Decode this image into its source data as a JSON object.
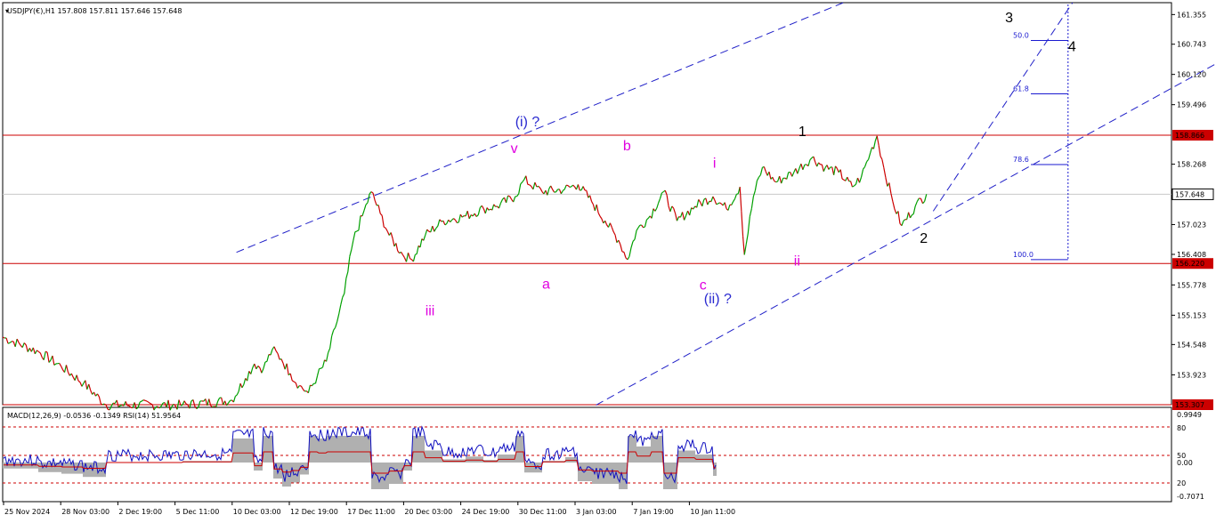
{
  "header": {
    "symbol_line": "USDJPY(€),H1  157.808 157.811 157.646 157.648",
    "indicator_line": "MACD(12,26,9) -0.0536 -0.1349  RSI(14) 51.9564"
  },
  "chart_data": {
    "type": "line",
    "title": "USDJPY(€),H1",
    "price_axis": {
      "ticks": [
        "161.355",
        "160.743",
        "160.120",
        "159.496",
        "158.268",
        "157.023",
        "156.408",
        "155.778",
        "155.153",
        "154.548",
        "153.923"
      ],
      "ylim": [
        153.307,
        161.6
      ]
    },
    "time_axis": {
      "ticks": [
        "25 Nov 2024",
        "28 Nov 03:00",
        "2 Dec 19:00",
        "5 Dec 11:00",
        "10 Dec 03:00",
        "12 Dec 19:00",
        "17 Dec 11:00",
        "20 Dec 03:00",
        "24 Dec 19:00",
        "30 Dec 11:00",
        "3 Jan 03:00",
        "7 Jan 19:00",
        "10 Jan 11:00"
      ]
    },
    "horizontal_lines": [
      {
        "price": 158.866,
        "label": "158.866",
        "color": "#cc0000"
      },
      {
        "price": 156.22,
        "label": "156.220",
        "color": "#cc0000"
      },
      {
        "price": 153.307,
        "label": "153.307",
        "color": "#cc0000"
      }
    ],
    "current_price": {
      "price": 157.648,
      "label": "157.648"
    },
    "price_path": [
      {
        "t": 0.0,
        "p": 154.7
      },
      {
        "t": 0.8,
        "p": 154.4
      },
      {
        "t": 1.3,
        "p": 154.1
      },
      {
        "t": 1.8,
        "p": 153.75
      },
      {
        "t": 2.3,
        "p": 153.3
      },
      {
        "t": 4.0,
        "p": 153.3
      },
      {
        "t": 5.1,
        "p": 153.4
      },
      {
        "t": 5.4,
        "p": 153.85
      },
      {
        "t": 5.6,
        "p": 154.15
      },
      {
        "t": 5.8,
        "p": 154.05
      },
      {
        "t": 6.0,
        "p": 154.45
      },
      {
        "t": 6.2,
        "p": 154.25
      },
      {
        "t": 6.4,
        "p": 153.95
      },
      {
        "t": 6.6,
        "p": 153.7
      },
      {
        "t": 6.8,
        "p": 153.55
      },
      {
        "t": 7.0,
        "p": 153.9
      },
      {
        "t": 7.2,
        "p": 154.2
      },
      {
        "t": 7.4,
        "p": 154.9
      },
      {
        "t": 7.6,
        "p": 155.6
      },
      {
        "t": 7.8,
        "p": 156.7
      },
      {
        "t": 8.0,
        "p": 157.2
      },
      {
        "t": 8.2,
        "p": 157.7
      },
      {
        "t": 8.4,
        "p": 157.25
      },
      {
        "t": 8.6,
        "p": 156.8
      },
      {
        "t": 8.9,
        "p": 156.4
      },
      {
        "t": 9.1,
        "p": 156.3
      },
      {
        "t": 9.4,
        "p": 156.8
      },
      {
        "t": 9.8,
        "p": 157.1
      },
      {
        "t": 10.3,
        "p": 157.2
      },
      {
        "t": 10.7,
        "p": 157.35
      },
      {
        "t": 11.0,
        "p": 157.4
      },
      {
        "t": 11.4,
        "p": 157.6
      },
      {
        "t": 11.6,
        "p": 157.95
      },
      {
        "t": 12.0,
        "p": 157.7
      },
      {
        "t": 12.5,
        "p": 157.75
      },
      {
        "t": 12.8,
        "p": 157.85
      },
      {
        "t": 13.1,
        "p": 157.5
      },
      {
        "t": 13.4,
        "p": 157.1
      },
      {
        "t": 13.7,
        "p": 156.7
      },
      {
        "t": 13.9,
        "p": 156.3
      },
      {
        "t": 14.1,
        "p": 156.9
      },
      {
        "t": 14.4,
        "p": 157.2
      },
      {
        "t": 14.7,
        "p": 157.7
      },
      {
        "t": 15.0,
        "p": 157.1
      },
      {
        "t": 15.4,
        "p": 157.4
      },
      {
        "t": 15.8,
        "p": 157.6
      },
      {
        "t": 16.1,
        "p": 157.35
      },
      {
        "t": 16.4,
        "p": 157.8
      },
      {
        "t": 16.5,
        "p": 156.4
      },
      {
        "t": 16.7,
        "p": 157.6
      },
      {
        "t": 16.9,
        "p": 158.2
      },
      {
        "t": 17.2,
        "p": 157.9
      },
      {
        "t": 17.6,
        "p": 158.1
      },
      {
        "t": 18.0,
        "p": 158.4
      },
      {
        "t": 18.3,
        "p": 158.2
      },
      {
        "t": 18.6,
        "p": 158.1
      },
      {
        "t": 18.9,
        "p": 157.8
      },
      {
        "t": 19.1,
        "p": 158.0
      },
      {
        "t": 19.3,
        "p": 158.5
      },
      {
        "t": 19.45,
        "p": 158.85
      },
      {
        "t": 19.6,
        "p": 158.2
      },
      {
        "t": 19.8,
        "p": 157.5
      },
      {
        "t": 20.0,
        "p": 157.0
      },
      {
        "t": 20.3,
        "p": 157.4
      },
      {
        "t": 20.55,
        "p": 157.65
      }
    ],
    "projection_lines": [
      {
        "from": {
          "t": 20.7,
          "p": 157.3
        },
        "to": {
          "t": 23.8,
          "p": 161.6
        }
      }
    ],
    "channel": {
      "upper": {
        "from": {
          "t": 5.2,
          "p": 156.45
        },
        "to": {
          "t": 18.7,
          "p": 161.6
        }
      },
      "lower": {
        "from": {
          "t": 13.2,
          "p": 153.3
        },
        "to": {
          "t": 27.5,
          "p": 160.6
        }
      }
    },
    "fib_levels": [
      {
        "label": "50.0",
        "price": 160.82
      },
      {
        "label": "61.8",
        "price": 159.72
      },
      {
        "label": "78.6",
        "price": 158.26
      },
      {
        "label": "100.0",
        "price": 156.3
      }
    ],
    "wave_labels": [
      {
        "text": "(i) ?",
        "t": 11.4,
        "p": 159.05,
        "color": "#2a2ad0"
      },
      {
        "text": "v",
        "t": 11.3,
        "p": 158.5,
        "color": "#e000e0"
      },
      {
        "text": "iii",
        "t": 9.4,
        "p": 155.15,
        "color": "#e000e0"
      },
      {
        "text": "a",
        "t": 12.0,
        "p": 155.7,
        "color": "#e000e0"
      },
      {
        "text": "b",
        "t": 13.8,
        "p": 158.55,
        "color": "#e000e0"
      },
      {
        "text": "c",
        "t": 15.5,
        "p": 155.68,
        "color": "#e000e0"
      },
      {
        "text": "(ii) ?",
        "t": 15.6,
        "p": 155.4,
        "color": "#2a2ad0"
      },
      {
        "text": "i",
        "t": 15.8,
        "p": 158.2,
        "color": "#e000e0"
      },
      {
        "text": "ii",
        "t": 17.6,
        "p": 156.18,
        "color": "#e000e0"
      },
      {
        "text": "1",
        "t": 17.7,
        "p": 158.85,
        "color": "#000000"
      },
      {
        "text": "2",
        "t": 20.4,
        "p": 156.65,
        "color": "#000000"
      },
      {
        "text": "3",
        "t": 22.3,
        "p": 161.2,
        "color": "#000000"
      },
      {
        "text": "4",
        "t": 23.7,
        "p": 160.6,
        "color": "#000000"
      }
    ],
    "indicator": {
      "macd_params": "MACD(12,26,9)",
      "macd_main": -0.0536,
      "macd_signal": -0.1349,
      "rsi_params": "RSI(14)",
      "rsi_value": 51.9564,
      "right_ticks": [
        "0.9949",
        "80",
        "50",
        "0.00",
        "20",
        "-0.7071"
      ]
    }
  }
}
